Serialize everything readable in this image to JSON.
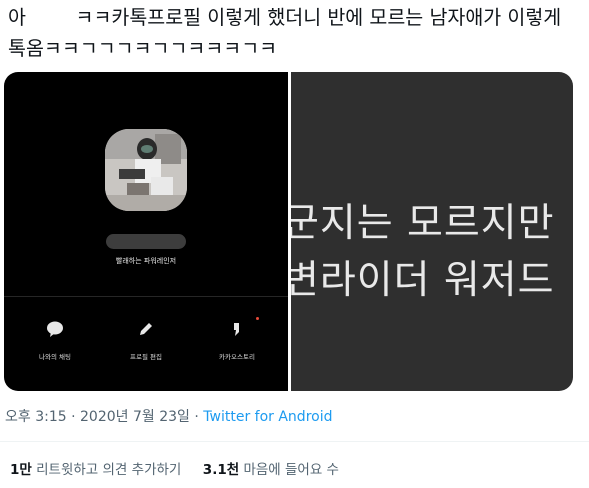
{
  "tweet": {
    "text": "아        ㅋㅋ카톡프로필 이렇게 했더니 반에 모르는 남자애가 이렇게 톡옴ㅋㅋㄱㄱㄱㅋㄱㄱㅋㅋㅋㄱㅋ"
  },
  "profile_screen": {
    "status_message": "빨래하는 파워레인저",
    "actions": [
      {
        "label": "나와의 채팅",
        "icon": "chat-bubble-icon"
      },
      {
        "label": "프로필 편집",
        "icon": "pencil-icon"
      },
      {
        "label": "카카오스토리",
        "icon": "kakaostory-quote-icon"
      }
    ]
  },
  "chat_zoom": {
    "line1": "군지는 모르지만",
    "line2": "변라이더 워저드"
  },
  "meta": {
    "time": "오후 3:15",
    "dot1": " · ",
    "date": "2020년 7월 23일",
    "dot2": " · ",
    "source": "Twitter for Android"
  },
  "stats": {
    "retweets_count": "1만",
    "retweets_label": "리트윗하고 의견 추가하기",
    "likes_count": "3.1천",
    "likes_label": "마음에 들어요 수"
  },
  "colors": {
    "text": "#0f1419",
    "secondary": "#536471",
    "link": "#1d9bf0"
  }
}
